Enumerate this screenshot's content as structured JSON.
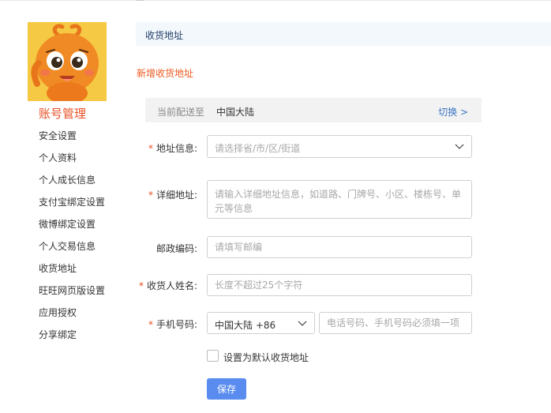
{
  "header": {
    "title": "收货地址"
  },
  "sidebar": {
    "account_title": "账号管理",
    "items": [
      {
        "label": "安全设置"
      },
      {
        "label": "个人资料"
      },
      {
        "label": "个人成长信息"
      },
      {
        "label": "支付宝绑定设置"
      },
      {
        "label": "微博绑定设置"
      },
      {
        "label": "个人交易信息"
      },
      {
        "label": "收货地址"
      },
      {
        "label": "旺旺网页版设置"
      },
      {
        "label": "应用授权"
      },
      {
        "label": "分享绑定"
      }
    ]
  },
  "main": {
    "new_address_link": "新增收货地址",
    "delivery": {
      "label": "当前配送至",
      "value": "中国大陆",
      "switch_label": "切换 >"
    },
    "form": {
      "required_mark": "*",
      "address": {
        "label": "地址信息:",
        "placeholder": "请选择省/市/区/街道"
      },
      "detail": {
        "label": "详细地址:",
        "placeholder": "请输入详细地址信息，如道路、门牌号、小区、楼栋号、单元等信息"
      },
      "zip": {
        "label": "邮政编码:",
        "placeholder": "请填写邮编"
      },
      "name": {
        "label": "收货人姓名:",
        "placeholder": "长度不超过25个字符"
      },
      "phone": {
        "label": "手机号码:",
        "country_code": "中国大陆 +86",
        "placeholder": "电话号码、手机号码必须填一项"
      },
      "default_checkbox_label": "设置为默认收货地址",
      "save_label": "保存"
    }
  },
  "colors": {
    "accent": "#e94f25",
    "link": "#3a76c4",
    "button": "#5a8cf0",
    "header_bg": "#f3f8fd"
  },
  "icons": {
    "address_select": "chevron-down-icon",
    "phone_select": "chevron-down-icon",
    "avatar": "taobao-mascot"
  }
}
